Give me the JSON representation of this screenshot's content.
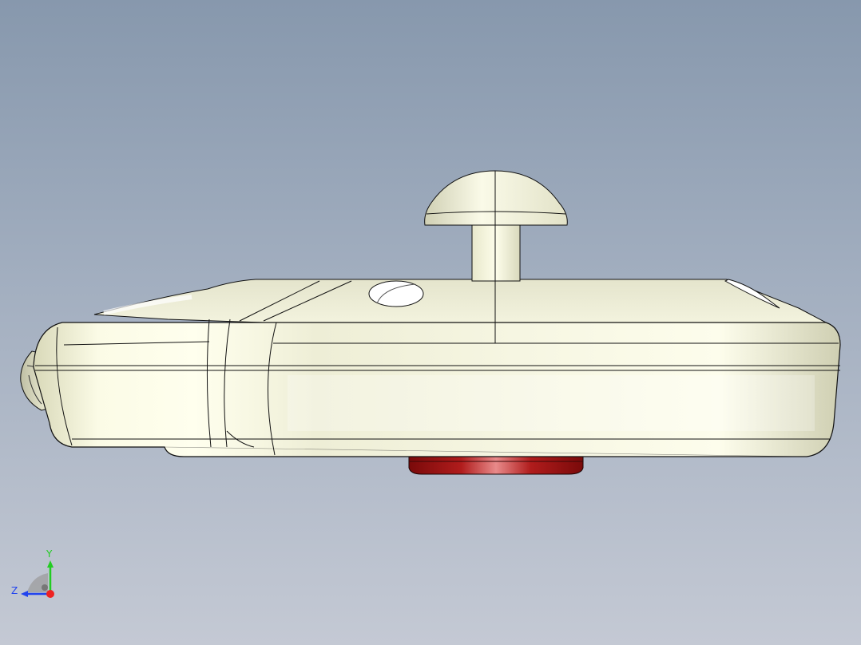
{
  "viewport": {
    "background_top": "#8798ad",
    "background_bottom": "#c4c9d4",
    "model_body_color": "#f4f4e0",
    "model_shade_color": "#d6d6b8",
    "button_color": "#a01818",
    "edge_color": "#111111"
  },
  "triad": {
    "y_label": "Y",
    "z_label": "Z",
    "y_color": "#22cc22",
    "z_color": "#2244ee",
    "x_color": "#ee2222"
  }
}
